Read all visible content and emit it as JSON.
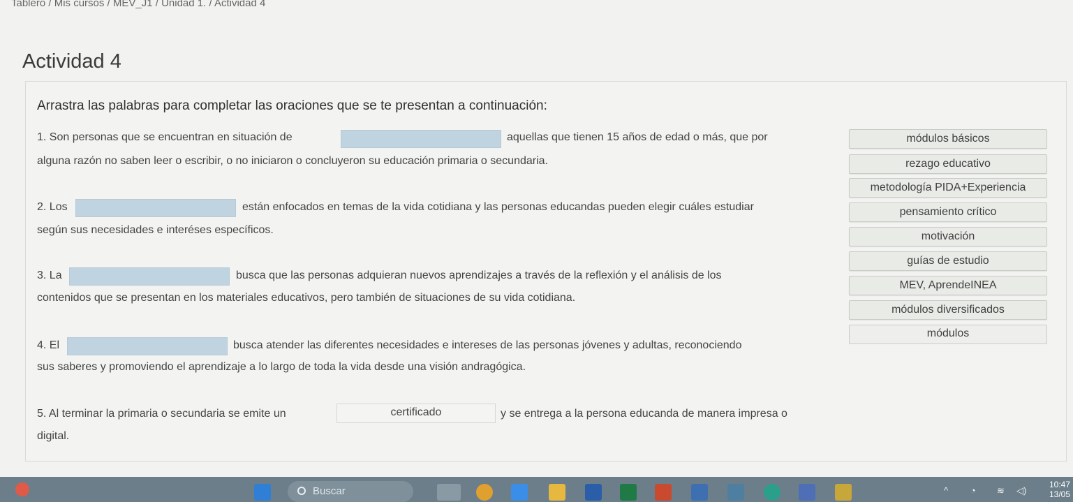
{
  "breadcrumb": "Tablero / Mis cursos / MEV_J1 / Unidad 1. / Actividad 4",
  "page_title": "Actividad 4",
  "instruction": "Arrastra las palabras para completar las oraciones que se te presentan a continuación:",
  "sentences": [
    {
      "before": "1. Son personas que se encuentran en situación de",
      "after": "aquellas que tienen 15 años de edad o más, que por",
      "line2": "alguna razón no saben leer o escribir, o no iniciaron o concluyeron su educación primaria o secundaria.",
      "slot": ""
    },
    {
      "before": "2. Los",
      "after": "están enfocados en temas de la vida cotidiana y las personas educandas pueden elegir cuáles estudiar",
      "line2": "según sus necesidades e interéses específicos.",
      "slot": ""
    },
    {
      "before": "3. La",
      "after": "busca que las personas adquieran nuevos aprendizajes a través de la reflexión y el análisis de los",
      "line2": "contenidos que se presentan en los materiales educativos, pero también de situaciones de su vida cotidiana.",
      "slot": ""
    },
    {
      "before": "4. El",
      "after": "busca atender las diferentes necesidades e intereses de las personas jóvenes y adultas, reconociendo",
      "line2": "sus saberes y promoviendo el aprendizaje a lo largo de toda la vida desde una visión andragógica.",
      "slot": ""
    },
    {
      "before": "5. Al terminar la primaria o secundaria se emite un",
      "after": "y se entrega a la persona educanda de manera impresa o",
      "line2": "digital.",
      "slot": "certificado"
    }
  ],
  "word_bank": [
    "módulos básicos",
    "rezago educativo",
    "metodología PIDA+Experiencia",
    "pensamiento crítico",
    "motivación",
    "guías de estudio",
    "MEV, AprendeINEA",
    "módulos diversificados",
    "módulos"
  ],
  "taskbar": {
    "search_label": "Buscar",
    "time": "10:47",
    "date": "13/05"
  },
  "colors": {
    "empty_slot": "#bfd3e0",
    "word_chip": "#e8ebe6",
    "taskbar": "#6b7e8a"
  }
}
